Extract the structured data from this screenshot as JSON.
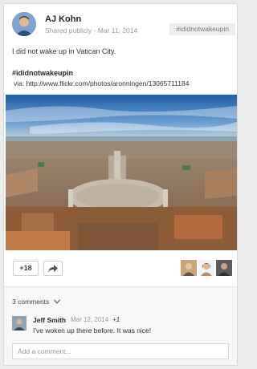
{
  "post": {
    "author": "AJ Kohn",
    "visibility": "Shared publicly",
    "separator": "-",
    "date": "Mar 11, 2014",
    "hashtag_chip": "#ididnotwakeupin",
    "text": "I did not wake up in Vatican City.",
    "hashtag": "#ididnotwakeupin",
    "via": "via: http://www.flickr.com/photos/aronningen/13065711184"
  },
  "actions": {
    "plus_count": "+18",
    "share_icon": "share-arrow-icon"
  },
  "comments": {
    "toggle_label": "3 comments",
    "items": [
      {
        "author": "Jeff Smith",
        "date": "Mar 12, 2014",
        "plus": "+1",
        "text": "I've woken up there before. It was nice!"
      }
    ],
    "add_placeholder": "Add a comment..."
  },
  "colors": {
    "card_bg": "#ffffff",
    "page_bg": "#ececec",
    "chip_bg": "#eeeeee",
    "comments_bg": "#f8f8f8"
  }
}
